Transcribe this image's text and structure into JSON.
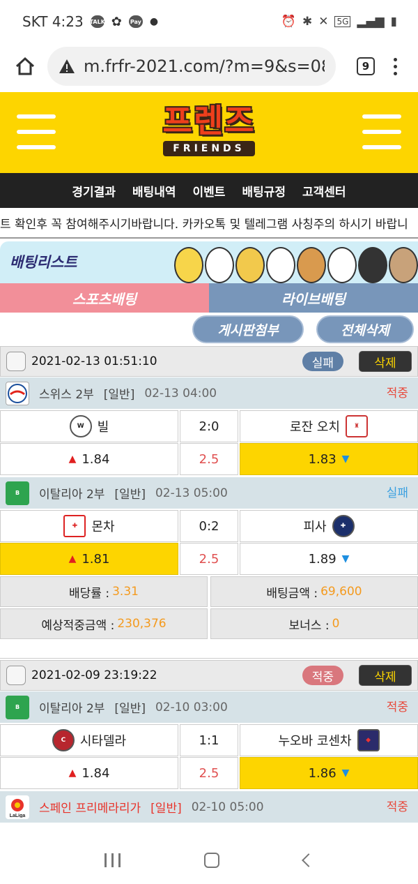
{
  "status_bar": {
    "carrier_time": "SKT 4:23",
    "icons": [
      "talk-icon",
      "flower-icon",
      "pay-icon",
      "dot-icon"
    ],
    "right_icons": [
      "alarm-icon",
      "bluetooth-icon",
      "mute-icon",
      "5g-icon",
      "signal-icon",
      "battery-icon"
    ]
  },
  "browser": {
    "url": "m.frfr-2021.com/?m=9&s=08",
    "tab_count": "9"
  },
  "site": {
    "logo_kr": "프렌즈",
    "logo_en": "FRIENDS"
  },
  "nav": [
    "경기결과",
    "배팅내역",
    "이벤트",
    "배팅규정",
    "고객센터"
  ],
  "ticker": "트 확인후 꼭 참여해주시기바랍니다. 카카오톡 및 텔레그램 사칭주의 하시기 바랍니",
  "banner_title": "배팅리스트",
  "tabs": {
    "sports": "스포츠배팅",
    "live": "라이브배팅"
  },
  "actions": {
    "board": "게시판첨부",
    "delete_all": "전체삭제"
  },
  "slips": [
    {
      "date": "2021-02-13 01:51:10",
      "status": "실패",
      "status_color": "#5f7fa6",
      "delete": "삭제",
      "games": [
        {
          "league": "스위스 2부",
          "kind": "[일반]",
          "time": "02-13 04:00",
          "result": "적중",
          "result_color": "#e84a3c",
          "home": "빌",
          "score": "2:0",
          "away": "로잔 오치",
          "odds_home": "1.84",
          "odds_draw": "2.5",
          "odds_away": "1.83",
          "selected": "away"
        },
        {
          "league": "이탈리아 2부",
          "kind": "[일반]",
          "time": "02-13 05:00",
          "result": "실패",
          "result_color": "#3aa0e0",
          "home": "몬차",
          "score": "0:2",
          "away": "피사",
          "odds_home": "1.81",
          "odds_draw": "2.5",
          "odds_away": "1.89",
          "selected": "home"
        }
      ],
      "summary": {
        "rate_label": "배당률 :",
        "rate": "3.31",
        "amount_label": "배팅금액 :",
        "amount": "69,600",
        "expected_label": "예상적중금액 :",
        "expected": "230,376",
        "bonus_label": "보너스 :",
        "bonus": "0"
      }
    },
    {
      "date": "2021-02-09 23:19:22",
      "status": "적중",
      "status_color": "#d9777d",
      "delete": "삭제",
      "games": [
        {
          "league": "이탈리아 2부",
          "kind": "[일반]",
          "time": "02-10 03:00",
          "result": "적중",
          "result_color": "#e84a3c",
          "home": "시타델라",
          "score": "1:1",
          "away": "누오바 코센차",
          "odds_home": "1.84",
          "odds_draw": "2.5",
          "odds_away": "1.86",
          "selected": "away"
        },
        {
          "league": "스페인 프리메라리가",
          "kind": "[일반]",
          "time": "02-10 05:00",
          "result": "적중",
          "result_color": "#e84a3c"
        }
      ]
    }
  ]
}
